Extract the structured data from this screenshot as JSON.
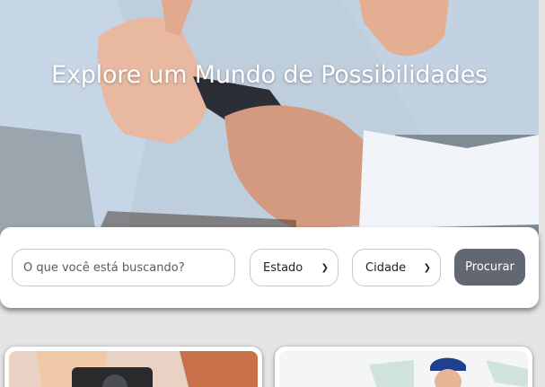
{
  "hero": {
    "title": "Explore um Mundo de Possibilidades"
  },
  "search": {
    "placeholder": "O que você está buscando?",
    "estado_label": "Estado",
    "cidade_label": "Cidade",
    "button_label": "Procurar"
  },
  "colors": {
    "button": "#616874",
    "page_background": "#e4e4e4"
  }
}
